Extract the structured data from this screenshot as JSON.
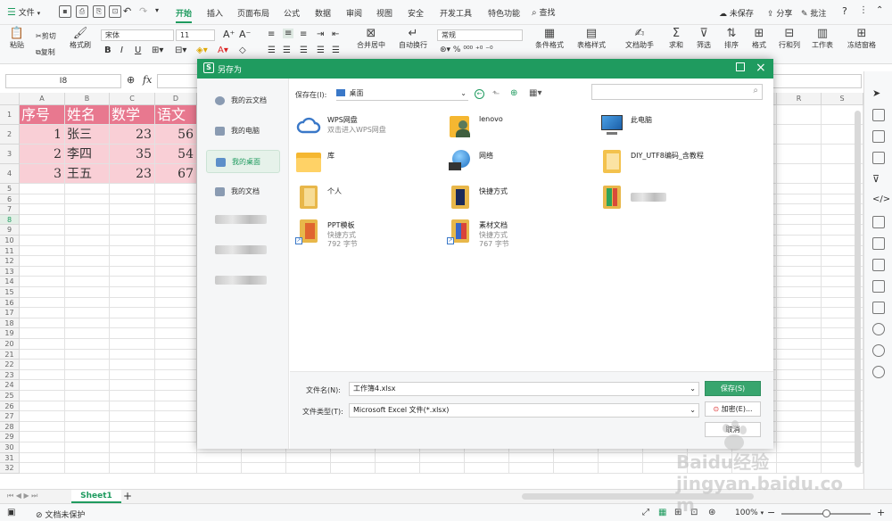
{
  "menubar": {
    "file_label": "文件",
    "tabs": [
      "开始",
      "插入",
      "页面布局",
      "公式",
      "数据",
      "审阅",
      "视图",
      "安全",
      "开发工具",
      "特色功能"
    ],
    "search_label": "查找",
    "unsaved_label": "未保存",
    "share_label": "分享",
    "comment_label": "批注"
  },
  "toolbar": {
    "paste": "粘贴",
    "cut": "剪切",
    "copy": "复制",
    "format_painter": "格式刷",
    "font_name": "宋体",
    "font_size": "11",
    "merge_center": "合并居中",
    "wrap_text": "自动换行",
    "number_format": "常规",
    "cond_format": "条件格式",
    "table_style": "表格样式",
    "doc_assistant": "文档助手",
    "sum": "求和",
    "filter": "筛选",
    "sort": "排序",
    "format": "格式",
    "rows_cols": "行和列",
    "worksheet": "工作表",
    "freeze": "冻结窗格"
  },
  "formula": {
    "cell_ref": "I8",
    "fx": "fx"
  },
  "sheet": {
    "columns": [
      "A",
      "B",
      "C",
      "D"
    ],
    "far_columns": [
      "R",
      "S"
    ],
    "rows": [
      "1",
      "2",
      "3",
      "4",
      "5",
      "6",
      "7",
      "8",
      "9",
      "10",
      "11",
      "12",
      "13",
      "14",
      "15",
      "16",
      "17",
      "18",
      "19",
      "20",
      "21",
      "22",
      "23",
      "24",
      "25",
      "26",
      "27",
      "28",
      "29",
      "30",
      "31",
      "32"
    ],
    "header_row": [
      "序号",
      "姓名",
      "数学",
      "语文"
    ],
    "data_rows": [
      [
        "1",
        "张三",
        "23",
        "56"
      ],
      [
        "2",
        "李四",
        "35",
        "54"
      ],
      [
        "3",
        "王五",
        "23",
        "67"
      ]
    ]
  },
  "tabs": {
    "sheet_name": "Sheet1",
    "add": "+"
  },
  "status": {
    "doc_protect": "文档未保护",
    "zoom": "100%"
  },
  "dialog": {
    "title": "另存为",
    "save_in_label": "保存在(I):",
    "save_in_value": "桌面",
    "sidebar": [
      "我的云文档",
      "我的电脑",
      "我的桌面",
      "我的文档"
    ],
    "files": [
      {
        "name": "WPS网盘",
        "sub": "双击进入WPS网盘"
      },
      {
        "name": "lenovo"
      },
      {
        "name": "此电脑"
      },
      {
        "name": "库"
      },
      {
        "name": "网络"
      },
      {
        "name": "DIY_UTF8编码_含教程"
      },
      {
        "name": "个人"
      },
      {
        "name": "快捷方式"
      },
      {
        "name": "PPT模板",
        "sub": "快捷方式",
        "size": "792 字节"
      },
      {
        "name": "素材文档",
        "sub": "快捷方式",
        "size": "767 字节"
      }
    ],
    "filename_label": "文件名(N):",
    "filename_value": "工作簿4.xlsx",
    "filetype_label": "文件类型(T):",
    "filetype_value": "Microsoft Excel 文件(*.xlsx)",
    "save_button": "保存(S)",
    "encrypt_button": "加密(E)...",
    "cancel_button": "取消"
  },
  "colors": {
    "accent": "#1f9b5f",
    "header_fill": "#e8788f",
    "row_fill": "#f9cfd6"
  },
  "watermark": "Baidu经验 jingyan.baidu.com"
}
